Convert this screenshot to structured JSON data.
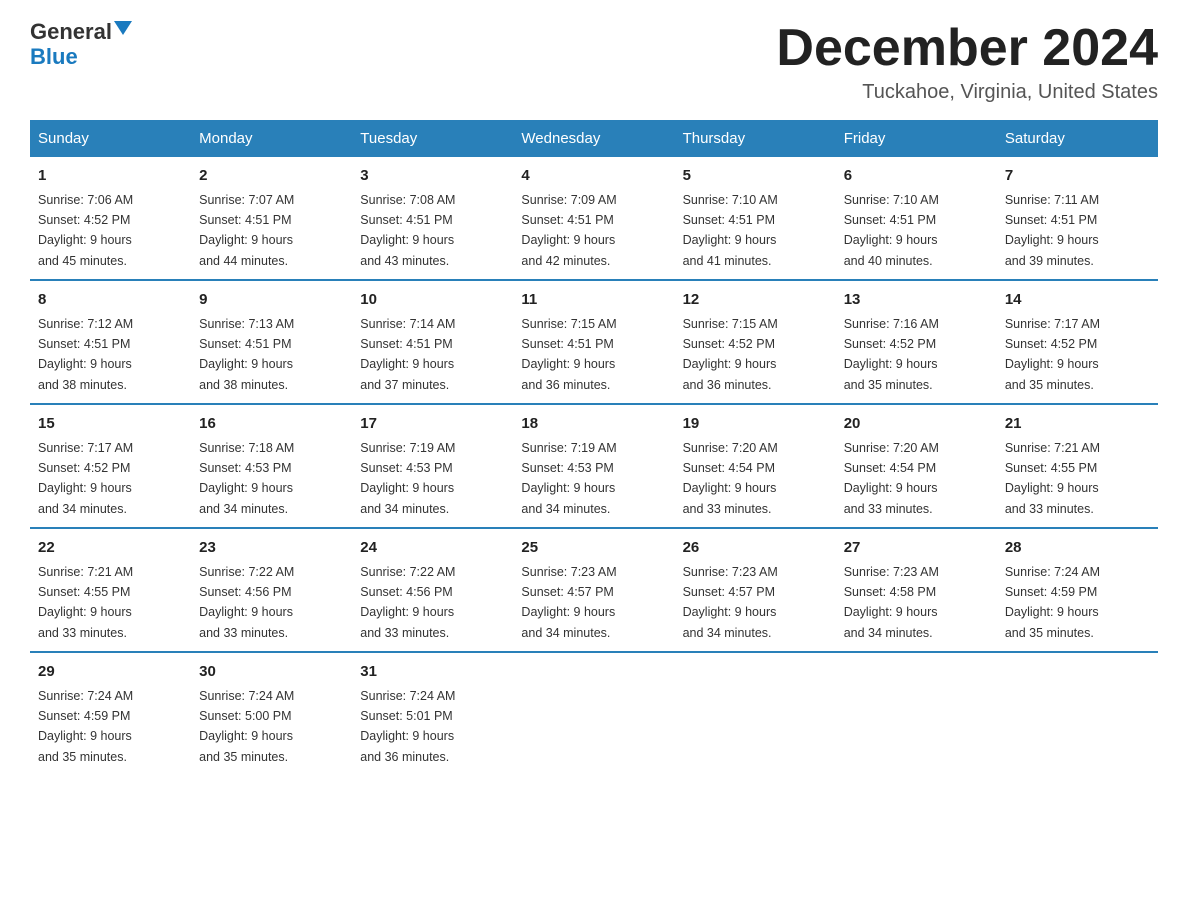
{
  "header": {
    "logo_line1": "General",
    "logo_arrow": "▲",
    "logo_line2": "Blue",
    "month_title": "December 2024",
    "location": "Tuckahoe, Virginia, United States"
  },
  "weekdays": [
    "Sunday",
    "Monday",
    "Tuesday",
    "Wednesday",
    "Thursday",
    "Friday",
    "Saturday"
  ],
  "weeks": [
    [
      {
        "day": "1",
        "sunrise": "7:06 AM",
        "sunset": "4:52 PM",
        "daylight": "9 hours and 45 minutes."
      },
      {
        "day": "2",
        "sunrise": "7:07 AM",
        "sunset": "4:51 PM",
        "daylight": "9 hours and 44 minutes."
      },
      {
        "day": "3",
        "sunrise": "7:08 AM",
        "sunset": "4:51 PM",
        "daylight": "9 hours and 43 minutes."
      },
      {
        "day": "4",
        "sunrise": "7:09 AM",
        "sunset": "4:51 PM",
        "daylight": "9 hours and 42 minutes."
      },
      {
        "day": "5",
        "sunrise": "7:10 AM",
        "sunset": "4:51 PM",
        "daylight": "9 hours and 41 minutes."
      },
      {
        "day": "6",
        "sunrise": "7:10 AM",
        "sunset": "4:51 PM",
        "daylight": "9 hours and 40 minutes."
      },
      {
        "day": "7",
        "sunrise": "7:11 AM",
        "sunset": "4:51 PM",
        "daylight": "9 hours and 39 minutes."
      }
    ],
    [
      {
        "day": "8",
        "sunrise": "7:12 AM",
        "sunset": "4:51 PM",
        "daylight": "9 hours and 38 minutes."
      },
      {
        "day": "9",
        "sunrise": "7:13 AM",
        "sunset": "4:51 PM",
        "daylight": "9 hours and 38 minutes."
      },
      {
        "day": "10",
        "sunrise": "7:14 AM",
        "sunset": "4:51 PM",
        "daylight": "9 hours and 37 minutes."
      },
      {
        "day": "11",
        "sunrise": "7:15 AM",
        "sunset": "4:51 PM",
        "daylight": "9 hours and 36 minutes."
      },
      {
        "day": "12",
        "sunrise": "7:15 AM",
        "sunset": "4:52 PM",
        "daylight": "9 hours and 36 minutes."
      },
      {
        "day": "13",
        "sunrise": "7:16 AM",
        "sunset": "4:52 PM",
        "daylight": "9 hours and 35 minutes."
      },
      {
        "day": "14",
        "sunrise": "7:17 AM",
        "sunset": "4:52 PM",
        "daylight": "9 hours and 35 minutes."
      }
    ],
    [
      {
        "day": "15",
        "sunrise": "7:17 AM",
        "sunset": "4:52 PM",
        "daylight": "9 hours and 34 minutes."
      },
      {
        "day": "16",
        "sunrise": "7:18 AM",
        "sunset": "4:53 PM",
        "daylight": "9 hours and 34 minutes."
      },
      {
        "day": "17",
        "sunrise": "7:19 AM",
        "sunset": "4:53 PM",
        "daylight": "9 hours and 34 minutes."
      },
      {
        "day": "18",
        "sunrise": "7:19 AM",
        "sunset": "4:53 PM",
        "daylight": "9 hours and 34 minutes."
      },
      {
        "day": "19",
        "sunrise": "7:20 AM",
        "sunset": "4:54 PM",
        "daylight": "9 hours and 33 minutes."
      },
      {
        "day": "20",
        "sunrise": "7:20 AM",
        "sunset": "4:54 PM",
        "daylight": "9 hours and 33 minutes."
      },
      {
        "day": "21",
        "sunrise": "7:21 AM",
        "sunset": "4:55 PM",
        "daylight": "9 hours and 33 minutes."
      }
    ],
    [
      {
        "day": "22",
        "sunrise": "7:21 AM",
        "sunset": "4:55 PM",
        "daylight": "9 hours and 33 minutes."
      },
      {
        "day": "23",
        "sunrise": "7:22 AM",
        "sunset": "4:56 PM",
        "daylight": "9 hours and 33 minutes."
      },
      {
        "day": "24",
        "sunrise": "7:22 AM",
        "sunset": "4:56 PM",
        "daylight": "9 hours and 33 minutes."
      },
      {
        "day": "25",
        "sunrise": "7:23 AM",
        "sunset": "4:57 PM",
        "daylight": "9 hours and 34 minutes."
      },
      {
        "day": "26",
        "sunrise": "7:23 AM",
        "sunset": "4:57 PM",
        "daylight": "9 hours and 34 minutes."
      },
      {
        "day": "27",
        "sunrise": "7:23 AM",
        "sunset": "4:58 PM",
        "daylight": "9 hours and 34 minutes."
      },
      {
        "day": "28",
        "sunrise": "7:24 AM",
        "sunset": "4:59 PM",
        "daylight": "9 hours and 35 minutes."
      }
    ],
    [
      {
        "day": "29",
        "sunrise": "7:24 AM",
        "sunset": "4:59 PM",
        "daylight": "9 hours and 35 minutes."
      },
      {
        "day": "30",
        "sunrise": "7:24 AM",
        "sunset": "5:00 PM",
        "daylight": "9 hours and 35 minutes."
      },
      {
        "day": "31",
        "sunrise": "7:24 AM",
        "sunset": "5:01 PM",
        "daylight": "9 hours and 36 minutes."
      },
      null,
      null,
      null,
      null
    ]
  ],
  "labels": {
    "sunrise": "Sunrise:",
    "sunset": "Sunset:",
    "daylight": "Daylight:"
  }
}
